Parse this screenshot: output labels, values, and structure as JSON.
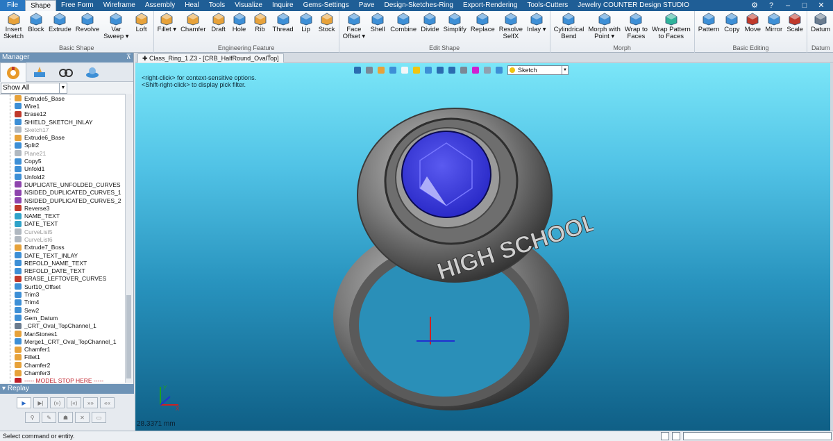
{
  "menu": {
    "items": [
      "File",
      "Shape",
      "Free Form",
      "Wireframe",
      "Assembly",
      "Heal",
      "Tools",
      "Visualize",
      "Inquire",
      "Gems-Settings",
      "Pave",
      "Design-Sketches-Ring",
      "Export-Rendering",
      "Tools-Cutters",
      "Jewelry COUNTER Design STUDIO"
    ],
    "active": "Shape"
  },
  "ribbon": {
    "groups": [
      {
        "label": "Basic Shape",
        "tools": [
          {
            "label": "Insert\nSketch",
            "icon": "sketch-icon",
            "color": "#e7a23a"
          },
          {
            "label": "Block",
            "icon": "block-icon",
            "color": "#3d8fd6"
          },
          {
            "label": "Extrude",
            "icon": "extrude-icon",
            "color": "#3d8fd6"
          },
          {
            "label": "Revolve",
            "icon": "revolve-icon",
            "color": "#3d8fd6"
          },
          {
            "label": "Var\nSweep ▾",
            "icon": "sweep-icon",
            "color": "#3d8fd6"
          },
          {
            "label": "Loft",
            "icon": "loft-icon",
            "color": "#e7a23a"
          }
        ]
      },
      {
        "label": "Engineering Feature",
        "tools": [
          {
            "label": "Fillet ▾",
            "icon": "fillet-icon",
            "color": "#e7a23a"
          },
          {
            "label": "Chamfer",
            "icon": "chamfer-icon",
            "color": "#e7a23a"
          },
          {
            "label": "Draft",
            "icon": "draft-icon",
            "color": "#e7a23a"
          },
          {
            "label": "Hole",
            "icon": "hole-icon",
            "color": "#3d8fd6"
          },
          {
            "label": "Rib",
            "icon": "rib-icon",
            "color": "#e7a23a"
          },
          {
            "label": "Thread",
            "icon": "thread-icon",
            "color": "#3d8fd6"
          },
          {
            "label": "Lip",
            "icon": "lip-icon",
            "color": "#3d8fd6"
          },
          {
            "label": "Stock",
            "icon": "stock-icon",
            "color": "#e7a23a"
          }
        ]
      },
      {
        "label": "Edit Shape",
        "tools": [
          {
            "label": "Face\nOffset ▾",
            "icon": "face-offset-icon",
            "color": "#3d8fd6"
          },
          {
            "label": "Shell",
            "icon": "shell-icon",
            "color": "#3d8fd6"
          },
          {
            "label": "Combine",
            "icon": "combine-icon",
            "color": "#3d8fd6"
          },
          {
            "label": "Divide",
            "icon": "divide-icon",
            "color": "#3d8fd6"
          },
          {
            "label": "Simplify",
            "icon": "simplify-icon",
            "color": "#3d8fd6"
          },
          {
            "label": "Replace",
            "icon": "replace-icon",
            "color": "#3d8fd6"
          },
          {
            "label": "Resolve\nSelfX",
            "icon": "resolve-icon",
            "color": "#3d8fd6"
          },
          {
            "label": "Inlay ▾",
            "icon": "inlay-icon",
            "color": "#3d8fd6"
          }
        ]
      },
      {
        "label": "Morph",
        "tools": [
          {
            "label": "Cylindrical\nBend",
            "icon": "bend-icon",
            "color": "#3d8fd6"
          },
          {
            "label": "Morph with\nPoint ▾",
            "icon": "morph-icon",
            "color": "#3d8fd6"
          },
          {
            "label": "Wrap to\nFaces",
            "icon": "wrap-icon",
            "color": "#3d8fd6"
          },
          {
            "label": "Wrap Pattern\nto Faces",
            "icon": "wrap-pattern-icon",
            "color": "#2fb39a"
          }
        ]
      },
      {
        "label": "Basic Editing",
        "tools": [
          {
            "label": "Pattern",
            "icon": "pattern-icon",
            "color": "#3d8fd6"
          },
          {
            "label": "Copy",
            "icon": "copy-icon",
            "color": "#3d8fd6"
          },
          {
            "label": "Move",
            "icon": "move-icon",
            "color": "#c0392b"
          },
          {
            "label": "Mirror",
            "icon": "mirror-icon",
            "color": "#3d8fd6"
          },
          {
            "label": "Scale",
            "icon": "scale-icon",
            "color": "#c0392b"
          }
        ]
      },
      {
        "label": "Datum",
        "tools": [
          {
            "label": "Datum",
            "icon": "datum-icon",
            "color": "#6b7c8f"
          }
        ]
      }
    ]
  },
  "manager": {
    "title": "Manager",
    "filter": "Show All",
    "tree": [
      {
        "label": "Extrude5_Base",
        "color": "#e7a23a",
        "dim": false
      },
      {
        "label": "Wire1",
        "color": "#3d8fd6",
        "dim": false
      },
      {
        "label": "Erase12",
        "color": "#c0392b",
        "dim": false
      },
      {
        "label": "SHIELD_SKETCH_INLAY",
        "color": "#3d8fd6",
        "dim": false
      },
      {
        "label": "Sketch17",
        "color": "#b0b8c0",
        "dim": true
      },
      {
        "label": "Extrude6_Base",
        "color": "#e7a23a",
        "dim": false
      },
      {
        "label": "Split2",
        "color": "#3d8fd6",
        "dim": false
      },
      {
        "label": "Plane21",
        "color": "#b0b8c0",
        "dim": true
      },
      {
        "label": "Copy5",
        "color": "#3d8fd6",
        "dim": false
      },
      {
        "label": "Unfold1",
        "color": "#3d8fd6",
        "dim": false
      },
      {
        "label": "Unfold2",
        "color": "#3d8fd6",
        "dim": false
      },
      {
        "label": "DUPLICATE_UNFOLDED_CURVES",
        "color": "#8e44ad",
        "dim": false
      },
      {
        "label": "NSIDED_DUPLICATED_CURVES_1",
        "color": "#8e44ad",
        "dim": false
      },
      {
        "label": "NSIDED_DUPLICATED_CURVES_2",
        "color": "#8e44ad",
        "dim": false
      },
      {
        "label": "Reverse3",
        "color": "#c0392b",
        "dim": false
      },
      {
        "label": "NAME_TEXT",
        "color": "#2fa3c9",
        "dim": false
      },
      {
        "label": "DATE_TEXT",
        "color": "#2fa3c9",
        "dim": false
      },
      {
        "label": "CurveList5",
        "color": "#b0b8c0",
        "dim": true
      },
      {
        "label": "CurveList6",
        "color": "#b0b8c0",
        "dim": true
      },
      {
        "label": "Extrude7_Boss",
        "color": "#e7a23a",
        "dim": false
      },
      {
        "label": "DATE_TEXT_INLAY",
        "color": "#3d8fd6",
        "dim": false
      },
      {
        "label": "REFOLD_NAME_TEXT",
        "color": "#3d8fd6",
        "dim": false
      },
      {
        "label": "REFOLD_DATE_TEXT",
        "color": "#3d8fd6",
        "dim": false
      },
      {
        "label": "ERASE_LEFTOVER_CURVES",
        "color": "#c0392b",
        "dim": false
      },
      {
        "label": "Surf10_Offset",
        "color": "#3d8fd6",
        "dim": false
      },
      {
        "label": "Trim3",
        "color": "#3d8fd6",
        "dim": false
      },
      {
        "label": "Trim4",
        "color": "#3d8fd6",
        "dim": false
      },
      {
        "label": "Sew2",
        "color": "#3d8fd6",
        "dim": false
      },
      {
        "label": "Gem_Datum",
        "color": "#3d8fd6",
        "dim": false
      },
      {
        "label": "_CRT_Oval_TopChannel_1",
        "color": "#6b7c8f",
        "dim": false
      },
      {
        "label": "ManStones1",
        "color": "#e7a23a",
        "dim": false
      },
      {
        "label": "Merge1_CRT_Oval_TopChannel_1",
        "color": "#3d8fd6",
        "dim": false
      },
      {
        "label": "Chamfer1",
        "color": "#e7a23a",
        "dim": false
      },
      {
        "label": "Fillet1",
        "color": "#e7a23a",
        "dim": false
      },
      {
        "label": "Chamfer2",
        "color": "#e7a23a",
        "dim": false
      },
      {
        "label": "Chamfer3",
        "color": "#e7a23a",
        "dim": false
      },
      {
        "label": "----- MODEL STOP HERE -----",
        "color": "#c0202a",
        "dim": false,
        "stop": true
      }
    ],
    "replay_title": "Replay"
  },
  "document": {
    "tab_label": "Class_Ring_1.Z3 - [CRB_HalfRound_OvalTop]"
  },
  "viewport": {
    "hint1": "<right-click> for context-sensitive options.",
    "hint2": "<Shift-right-click> to display pick filter.",
    "mode": "Sketch",
    "ring_text": "HIGH SCHOOL",
    "dimension": "28.3371 mm",
    "gem_color": "#2a2ac8"
  },
  "status": {
    "text": "Select command or entity."
  }
}
